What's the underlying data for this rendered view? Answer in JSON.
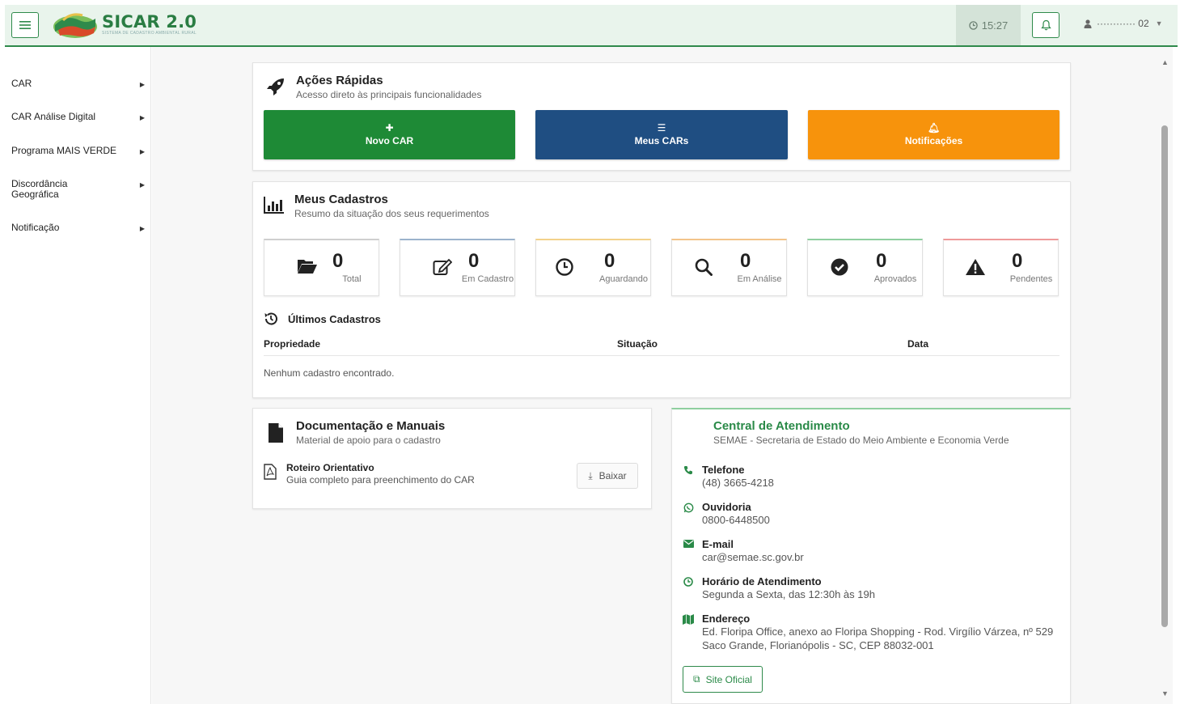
{
  "app": {
    "title": "SICAR 2.0",
    "subtitle": "SISTEMA DE CADASTRO AMBIENTAL RURAL"
  },
  "header": {
    "clock": "15:27",
    "user": "············ 02"
  },
  "sidebar": {
    "items": [
      {
        "label": "CAR"
      },
      {
        "label": "CAR Análise Digital"
      },
      {
        "label": "Programa MAIS VERDE"
      },
      {
        "label": "Discordância Geográfica"
      },
      {
        "label": "Notificação"
      }
    ]
  },
  "quick_actions": {
    "title": "Ações Rápidas",
    "subtitle": "Acesso direto às principais funcionalidades",
    "buttons": [
      {
        "label": "Novo CAR",
        "icon": "plus-icon",
        "color": "#1e8a36"
      },
      {
        "label": "Meus CARs",
        "icon": "list-icon",
        "color": "#1f4e82"
      },
      {
        "label": "Notificações",
        "icon": "bell-icon",
        "color": "#f7930c"
      }
    ]
  },
  "registrations": {
    "title": "Meus Cadastros",
    "subtitle": "Resumo da situação dos seus requerimentos",
    "stats": [
      {
        "label": "Total",
        "value": "0",
        "icon": "folder-open-icon",
        "accent": "#cfcfcf"
      },
      {
        "label": "Em Cadastro",
        "value": "0",
        "icon": "edit-icon",
        "accent": "#9bb3cc"
      },
      {
        "label": "Aguardando",
        "value": "0",
        "icon": "clock-icon",
        "accent": "#f3d28a"
      },
      {
        "label": "Em Análise",
        "value": "0",
        "icon": "search-icon",
        "accent": "#f3c48a"
      },
      {
        "label": "Aprovados",
        "value": "0",
        "icon": "check-circle-icon",
        "accent": "#8fcf9f"
      },
      {
        "label": "Pendentes",
        "value": "0",
        "icon": "warning-icon",
        "accent": "#ef9a9a"
      }
    ],
    "latest_title": "Últimos Cadastros",
    "columns": [
      "Propriedade",
      "Situação",
      "Data"
    ],
    "empty_message": "Nenhum cadastro encontrado."
  },
  "documents": {
    "title": "Documentação e Manuais",
    "subtitle": "Material de apoio para o cadastro",
    "items": [
      {
        "title": "Roteiro Orientativo",
        "subtitle": "Guia completo para preenchimento do CAR",
        "button": "Baixar"
      }
    ]
  },
  "contact": {
    "title": "Central de Atendimento",
    "subtitle": "SEMAE - Secretaria de Estado do Meio Ambiente e Economia Verde",
    "rows": [
      {
        "label": "Telefone",
        "value": "(48) 3665-4218",
        "icon": "phone-icon"
      },
      {
        "label": "Ouvidoria",
        "value": "0800-6448500",
        "icon": "whatsapp-icon"
      },
      {
        "label": "E-mail",
        "value": "car@semae.sc.gov.br",
        "icon": "envelope-icon"
      },
      {
        "label": "Horário de Atendimento",
        "value": "Segunda a Sexta, das 12:30h às 19h",
        "icon": "clock-icon"
      },
      {
        "label": "Endereço",
        "value": "Ed. Floripa Office, anexo ao Floripa Shopping - Rod. Virgílio Várzea, nº 529",
        "value2": "Saco Grande, Florianópolis - SC, CEP 88032-001",
        "icon": "map-icon"
      }
    ],
    "site_button": "Site Oficial"
  }
}
